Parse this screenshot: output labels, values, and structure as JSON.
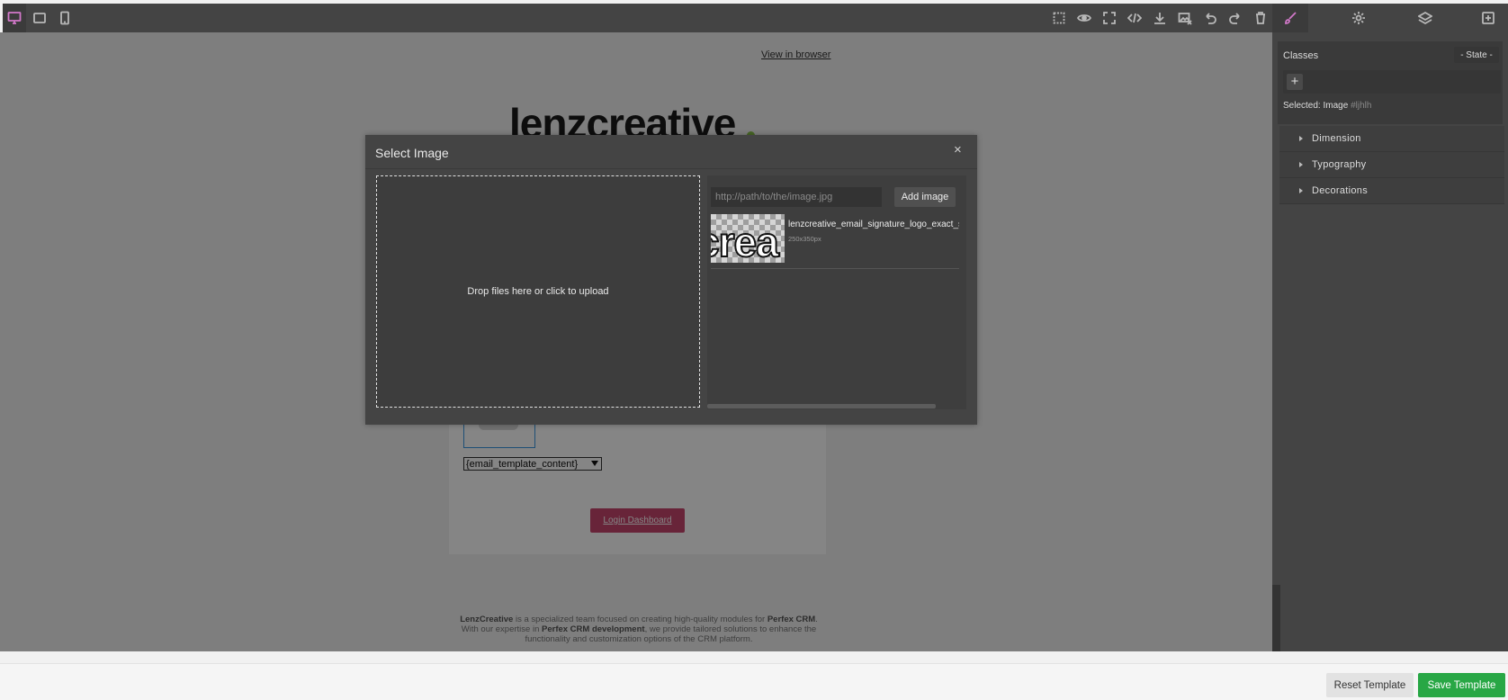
{
  "toolbar": {
    "devices": [
      "desktop-icon",
      "tablet-icon",
      "mobile-icon"
    ],
    "actions": [
      "sw-visibility-icon",
      "preview-icon",
      "fullscreen-icon",
      "code-icon",
      "download-icon",
      "clear-images-icon",
      "undo-icon",
      "redo-icon",
      "trash-icon"
    ],
    "panels": [
      "style-manager-icon",
      "settings-icon",
      "layers-icon",
      "blocks-icon"
    ],
    "accent": "#d278c9"
  },
  "canvas": {
    "view_in_browser": "View in browser",
    "logo_text": "lenzcreative",
    "template_select_value": "{email_template_content}",
    "login_button": "Login Dashboard",
    "footer": {
      "brand": "LenzCreative",
      "text1": " is a specialized team focused on creating high-quality modules for ",
      "product": "Perfex CRM",
      "text2": ". With our expertise in ",
      "product_dev": "Perfex CRM development",
      "text3": ", we provide tailored solutions to enhance the functionality and customization options of the CRM platform."
    }
  },
  "style_panel": {
    "classes_label": "Classes",
    "state_label": "- State -",
    "add_class": "+",
    "selected_prefix": "Selected:",
    "selected_name": "Image",
    "selected_id": "#ljhlh",
    "sectors": [
      "Dimension",
      "Typography",
      "Decorations"
    ]
  },
  "modal": {
    "title": "Select Image",
    "close": "×",
    "dropzone_text": "Drop files here or click to upload",
    "url_placeholder": "http://path/to/the/image.jpg",
    "add_image_label": "Add image",
    "assets": [
      {
        "name": "lenzcreative_email_signature_logo_exact_size.png",
        "dims": "250x350px",
        "thumb_text": "crea"
      }
    ]
  },
  "bottom_bar": {
    "reset_label": "Reset Template",
    "save_label": "Save Template",
    "save_color": "#28a745"
  }
}
